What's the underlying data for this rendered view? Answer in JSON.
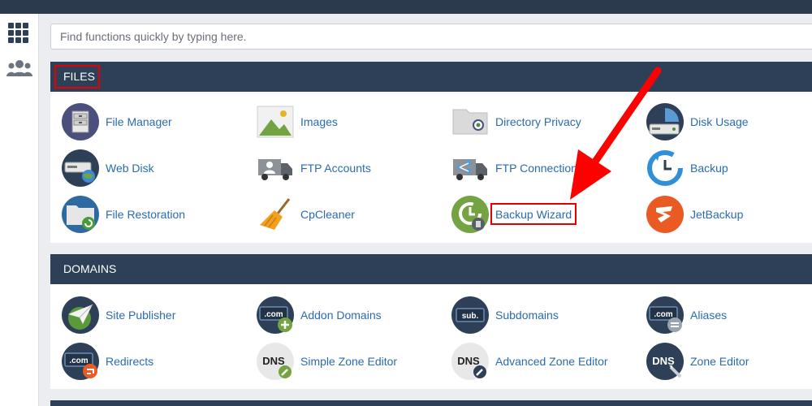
{
  "search": {
    "placeholder": "Find functions quickly by typing here."
  },
  "sidebar": {
    "items": [
      {
        "icon": "grid-icon"
      },
      {
        "icon": "users-icon"
      }
    ]
  },
  "files": {
    "title": "FILES",
    "items": [
      {
        "label": "File Manager",
        "icon": "file-manager-icon"
      },
      {
        "label": "Images",
        "icon": "images-icon"
      },
      {
        "label": "Directory Privacy",
        "icon": "directory-privacy-icon"
      },
      {
        "label": "Disk Usage",
        "icon": "disk-usage-icon"
      },
      {
        "label": "Web Disk",
        "icon": "web-disk-icon"
      },
      {
        "label": "FTP Accounts",
        "icon": "ftp-accounts-icon"
      },
      {
        "label": "FTP Connections",
        "icon": "ftp-connections-icon"
      },
      {
        "label": "Backup",
        "icon": "backup-icon"
      },
      {
        "label": "File Restoration",
        "icon": "file-restoration-icon"
      },
      {
        "label": "CpCleaner",
        "icon": "cpcleaner-icon"
      },
      {
        "label": "Backup Wizard",
        "icon": "backup-wizard-icon"
      },
      {
        "label": "JetBackup",
        "icon": "jetbackup-icon"
      }
    ]
  },
  "domains": {
    "title": "DOMAINS",
    "items": [
      {
        "label": "Site Publisher",
        "icon": "site-publisher-icon"
      },
      {
        "label": "Addon Domains",
        "icon": "addon-domains-icon",
        "badge": ".com"
      },
      {
        "label": "Subdomains",
        "icon": "subdomains-icon",
        "badge": "sub."
      },
      {
        "label": "Aliases",
        "icon": "aliases-icon",
        "badge": ".com"
      },
      {
        "label": "Redirects",
        "icon": "redirects-icon",
        "badge": ".com"
      },
      {
        "label": "Simple Zone Editor",
        "icon": "simple-zone-editor-icon",
        "badge": "DNS"
      },
      {
        "label": "Advanced Zone Editor",
        "icon": "advanced-zone-editor-icon",
        "badge": "DNS"
      },
      {
        "label": "Zone Editor",
        "icon": "zone-editor-icon",
        "badge": "DNS"
      }
    ]
  },
  "colors": {
    "header_bg": "#2e4058",
    "link": "#2a6bb0",
    "highlight": "#e20000"
  }
}
